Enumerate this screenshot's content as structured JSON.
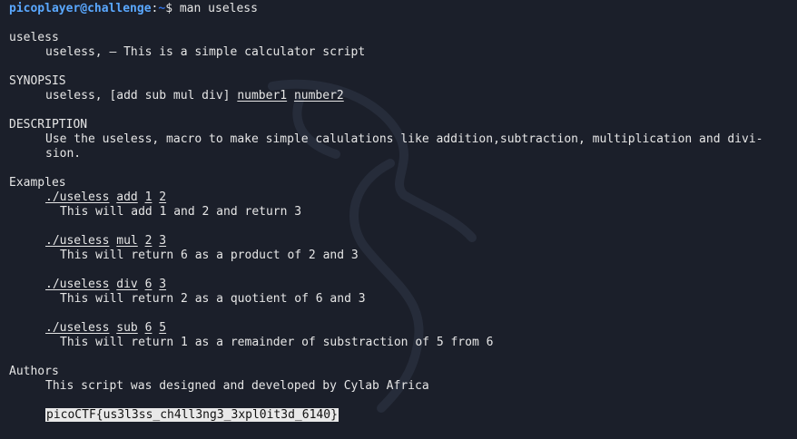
{
  "prompt": {
    "user_host": "picoplayer@challenge",
    "path": "~",
    "symbol": "$",
    "command": "man useless"
  },
  "man": {
    "name_heading": "useless",
    "name_desc": "useless, — This is a simple calculator script",
    "synopsis_heading": "SYNOPSIS",
    "synopsis_cmd": "useless, [add sub mul div]",
    "synopsis_arg1": "number1",
    "synopsis_arg2": "number2",
    "description_heading": "DESCRIPTION",
    "description_line1": "Use the useless, macro to make simple calulations like addition,subtraction, multiplication and divi-",
    "description_line2": "sion.",
    "examples_heading": "Examples",
    "examples": [
      {
        "cmd": "./useless",
        "op": "add",
        "a": "1",
        "b": "2",
        "desc": "This will add 1 and 2 and return 3"
      },
      {
        "cmd": "./useless",
        "op": "mul",
        "a": "2",
        "b": "3",
        "desc": "This will return 6 as a product of 2 and 3"
      },
      {
        "cmd": "./useless",
        "op": "div",
        "a": "6",
        "b": "3",
        "desc": "This will return 2 as a quotient of 6 and 3"
      },
      {
        "cmd": "./useless",
        "op": "sub",
        "a": "6",
        "b": "5",
        "desc": "This will return 1 as a remainder of substraction of 5 from 6"
      }
    ],
    "authors_heading": "Authors",
    "authors_text": "This script was designed and developed by Cylab Africa",
    "flag": "picoCTF{us3l3ss_ch4ll3ng3_3xpl0it3d_6140}"
  },
  "colors": {
    "background": "#1b1f2a",
    "text": "#e6e6e6",
    "prompt_user": "#5aa8ff",
    "prompt_path": "#2f6fe0"
  }
}
